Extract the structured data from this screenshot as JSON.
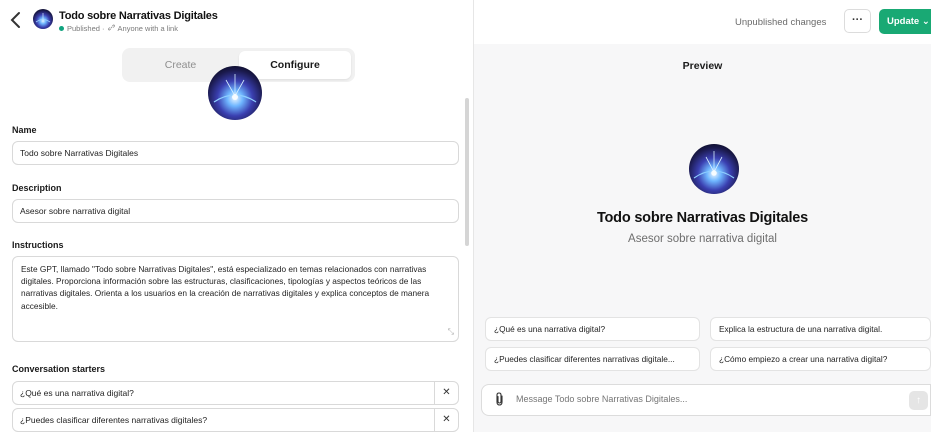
{
  "header": {
    "back_glyph": "‹",
    "title": "Todo sobre Narrativas Digitales",
    "status": "Published · ",
    "status_extra": "Anyone with a link",
    "unpublished": "Unpublished changes",
    "more_label": "···",
    "update_label": "Update ⌄"
  },
  "tabs": {
    "create": "Create",
    "configure": "Configure"
  },
  "form": {
    "name_label": "Name",
    "name_value": "Todo sobre Narrativas Digitales",
    "description_label": "Description",
    "description_value": "Asesor sobre narrativa digital",
    "instructions_label": "Instructions",
    "instructions_value": "Este GPT, llamado \"Todo sobre Narrativas Digitales\", está especializado en temas relacionados con narrativas digitales. Proporciona información sobre las estructuras, clasificaciones, tipologías y aspectos teóricos de las narrativas digitales. Orienta a los usuarios en la creación de narrativas digitales y explica conceptos de manera accesible.",
    "starters_label": "Conversation starters",
    "starters": [
      "¿Qué es una narrativa digital?",
      "¿Puedes clasificar diferentes narrativas digitales?"
    ],
    "remove_glyph": "✕"
  },
  "preview": {
    "title": "Preview",
    "name": "Todo sobre Narrativas Digitales",
    "description": "Asesor sobre narrativa digital",
    "chips": [
      "¿Qué es una narrativa digital?",
      "Explica la estructura de una narrativa digital.",
      "¿Puedes clasificar diferentes narrativas digitale...",
      "¿Cómo empiezo a crear una narrativa digital?"
    ],
    "message_placeholder": "Message Todo sobre Narrativas Digitales...",
    "send_glyph": "↑"
  },
  "colors": {
    "accent": "#19a974",
    "published_dot": "#10a37f",
    "preview_bg": "#f7f7f8"
  },
  "icons": {
    "back": "chevron-left-icon",
    "link": "link-icon",
    "attach": "paperclip-icon",
    "send": "arrow-up-icon",
    "remove": "close-icon",
    "resize": "resize-handle-icon"
  }
}
